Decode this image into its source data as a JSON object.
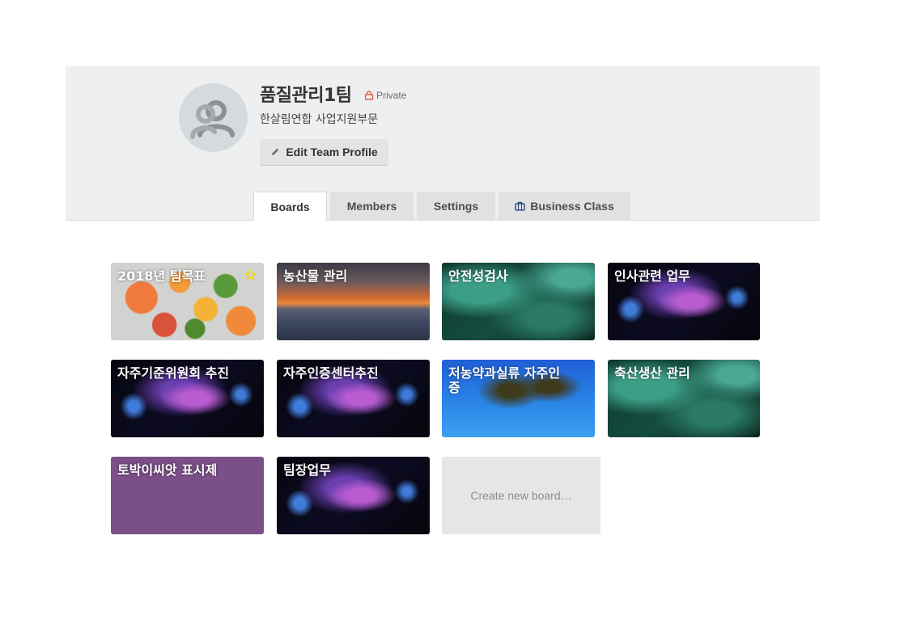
{
  "team": {
    "name": "품질관리1팀",
    "privacy": "Private",
    "description": "한살림연합 사업지원부문",
    "edit_label": "Edit Team Profile"
  },
  "tabs": [
    {
      "label": "Boards"
    },
    {
      "label": "Members"
    },
    {
      "label": "Settings"
    },
    {
      "label": "Business Class"
    }
  ],
  "boards": [
    {
      "title": "2018년 팀목표",
      "background": "fruit",
      "starred": true
    },
    {
      "title": "농산물 관리",
      "background": "sunset"
    },
    {
      "title": "안전성검사",
      "background": "green"
    },
    {
      "title": "인사관련 업무",
      "background": "nebula"
    },
    {
      "title": "자주기준위원회 추진",
      "background": "nebula"
    },
    {
      "title": "자주인증센터추진",
      "background": "nebula"
    },
    {
      "title": "저농약과실류 자주인증",
      "background": "palm"
    },
    {
      "title": "축산생산 관리",
      "background": "green"
    },
    {
      "title": "토박이씨앗 표시제",
      "background": "purple"
    },
    {
      "title": "팀장업무",
      "background": "nebula"
    }
  ],
  "create_board_label": "Create new board…",
  "colors": {
    "header_bg": "#edeff0",
    "private_lock": "#eb5a46",
    "star": "#f2d600",
    "business_icon": "#1f3f7a"
  }
}
